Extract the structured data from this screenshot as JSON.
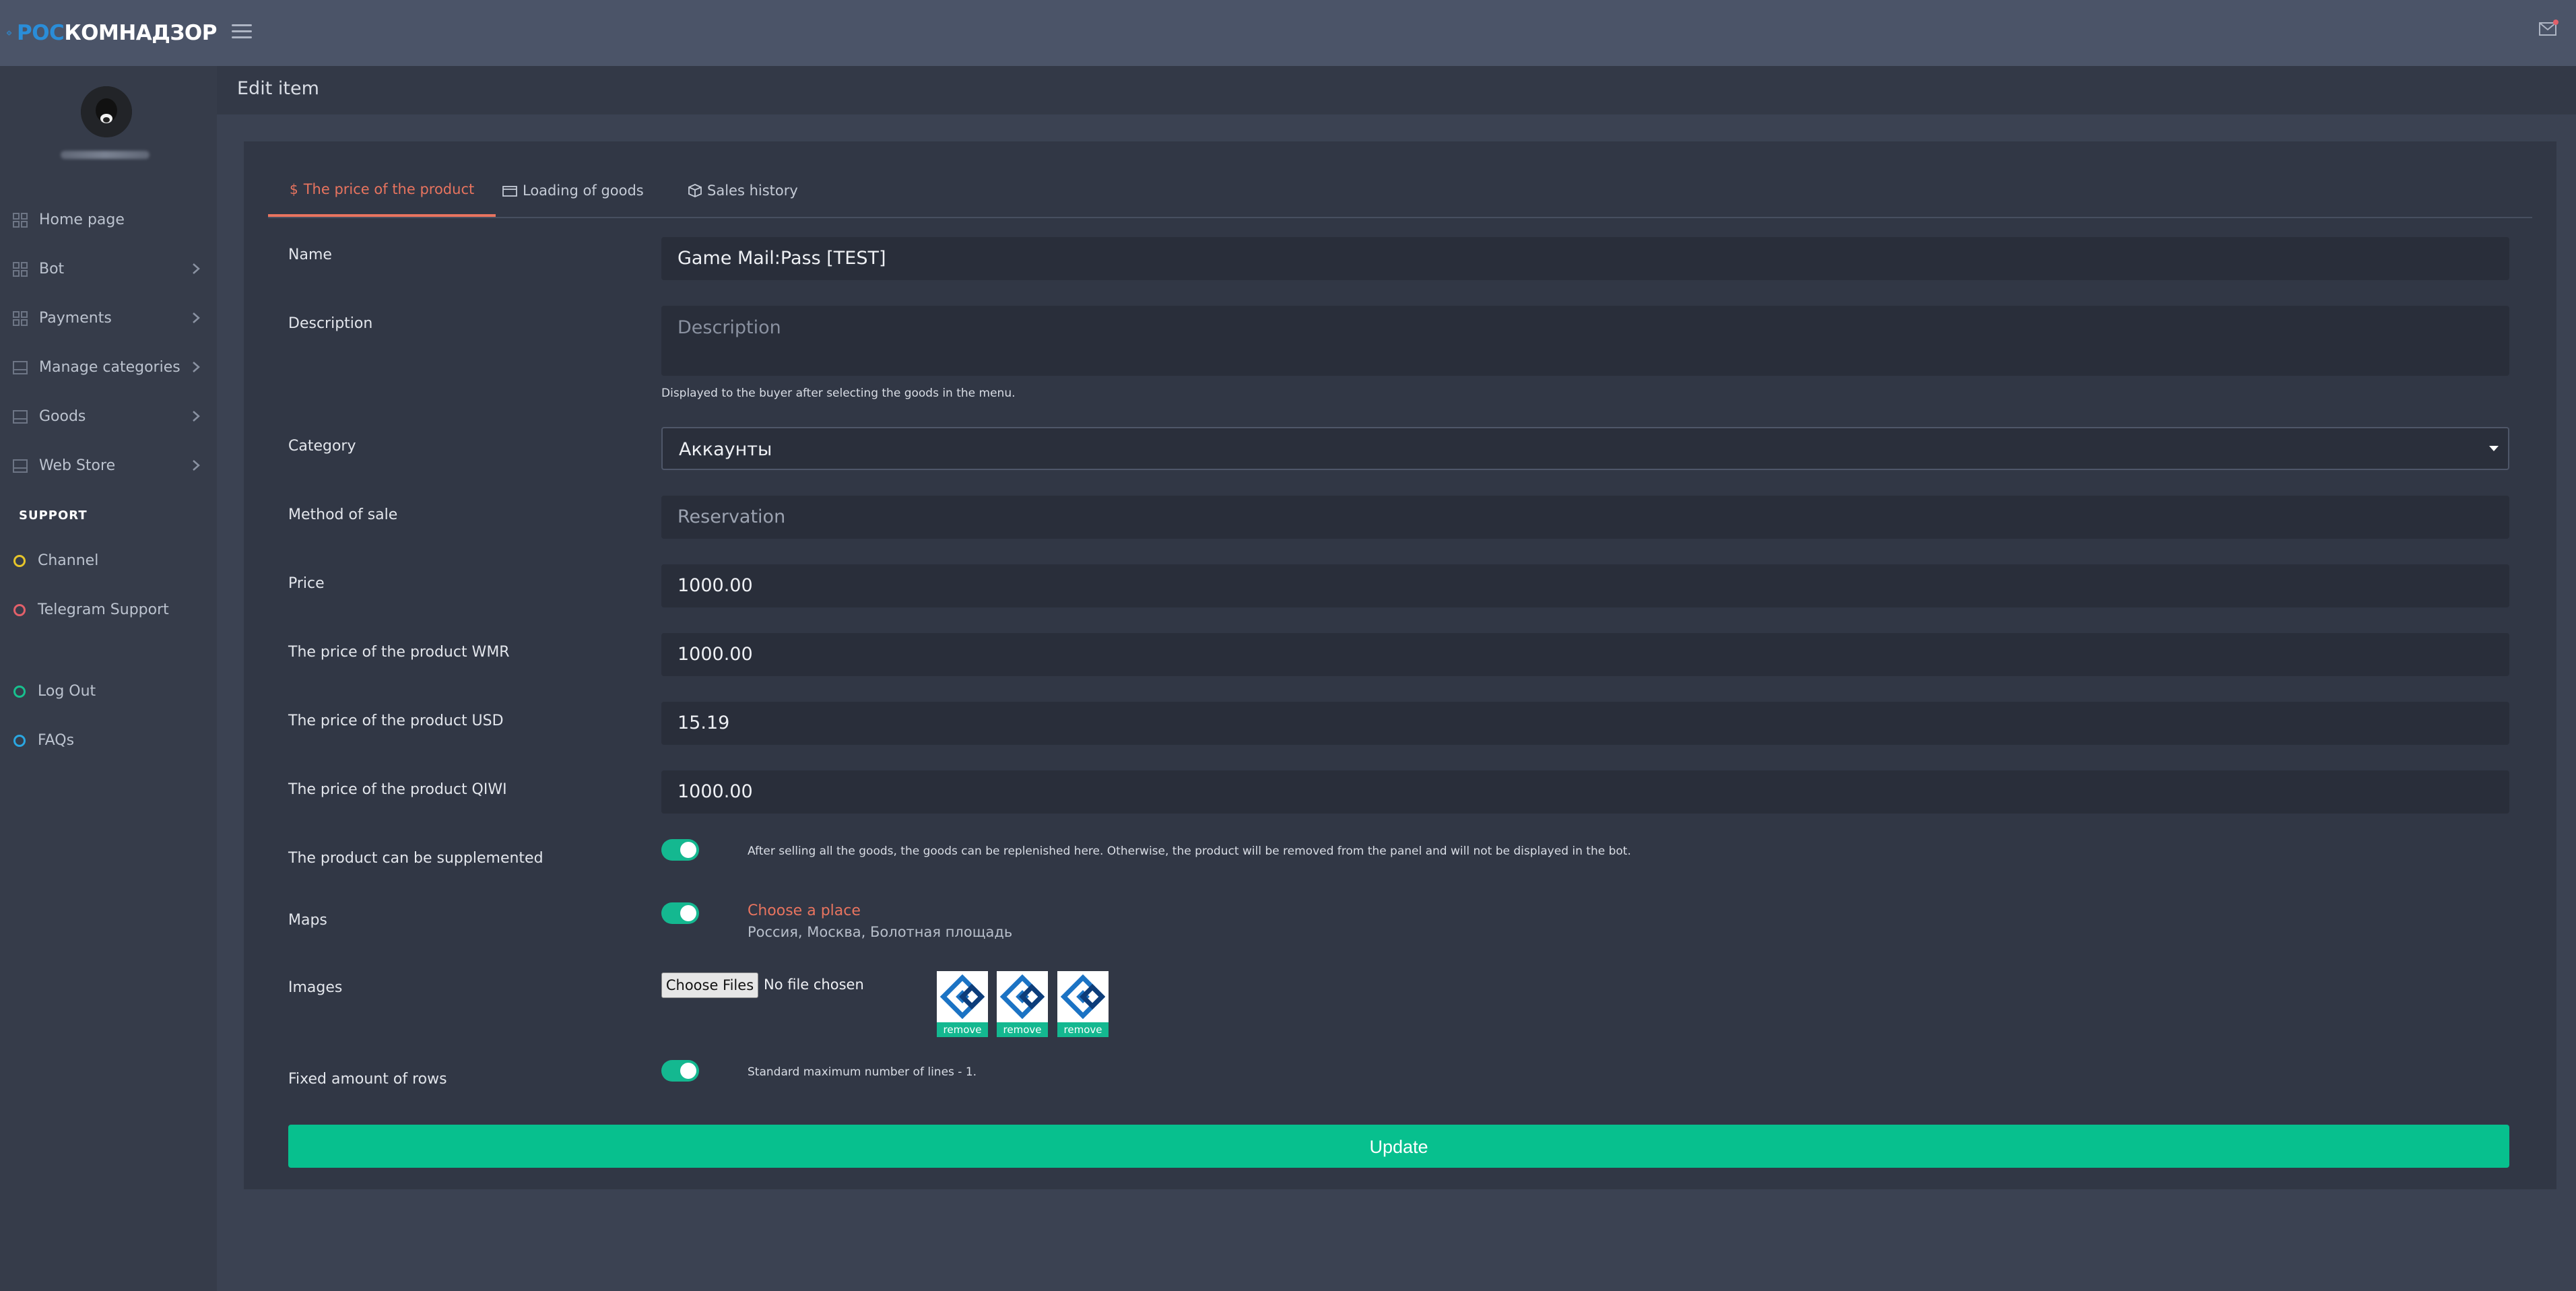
{
  "brand": {
    "part1": "РОС",
    "part2": "КОМНАДЗОР"
  },
  "sidebar": {
    "items": [
      {
        "label": "Home page"
      },
      {
        "label": "Bot"
      },
      {
        "label": "Payments"
      },
      {
        "label": "Manage categories"
      },
      {
        "label": "Goods"
      },
      {
        "label": "Web Store"
      }
    ],
    "support_title": "SUPPORT",
    "support_items": [
      {
        "label": "Channel",
        "color": "#e6c52a"
      },
      {
        "label": "Telegram Support",
        "color": "#e2606a"
      }
    ],
    "extra_items": [
      {
        "label": "Log Out",
        "color": "#18c08e"
      },
      {
        "label": "FAQs",
        "color": "#2aa6e0"
      }
    ]
  },
  "header": {
    "title": "Edit item"
  },
  "tabs": [
    {
      "label": "The price of the product",
      "icon": "dollar-icon"
    },
    {
      "label": "Loading of goods",
      "icon": "folder-icon"
    },
    {
      "label": "Sales history",
      "icon": "box-icon"
    }
  ],
  "form": {
    "name": {
      "label": "Name",
      "value": "Game Mail:Pass [TEST]"
    },
    "description": {
      "label": "Description",
      "placeholder": "Description",
      "hint": "Displayed to the buyer after selecting the goods in the menu."
    },
    "category": {
      "label": "Category",
      "value": "Аккаунты"
    },
    "method": {
      "label": "Method of sale",
      "value": "Reservation"
    },
    "price": {
      "label": "Price",
      "value": "1000.00"
    },
    "price_wmr": {
      "label": "The price of the product WMR",
      "value": "1000.00"
    },
    "price_usd": {
      "label": "The price of the product USD",
      "value": "15.19"
    },
    "price_qiwi": {
      "label": "The price of the product QIWI",
      "value": "1000.00"
    },
    "supplement": {
      "label": "The product can be supplemented",
      "enabled": true,
      "hint": "After selling all the goods, the goods can be replenished here. Otherwise, the product will be removed from the panel and will not be displayed in the bot."
    },
    "maps": {
      "label": "Maps",
      "enabled": true,
      "link": "Choose a place",
      "address": "Россия, Москва, Болотная площадь"
    },
    "images": {
      "label": "Images",
      "button": "Choose Files",
      "status": "No file chosen",
      "remove_label": "remove",
      "count": 3
    },
    "fixed_rows": {
      "label": "Fixed amount of rows",
      "enabled": true,
      "hint": "Standard maximum number of lines - 1."
    }
  },
  "actions": {
    "update": "Update"
  },
  "colors": {
    "accent": "#e8745f",
    "success": "#07c08e",
    "brand_blue": "#2a8dd8"
  }
}
